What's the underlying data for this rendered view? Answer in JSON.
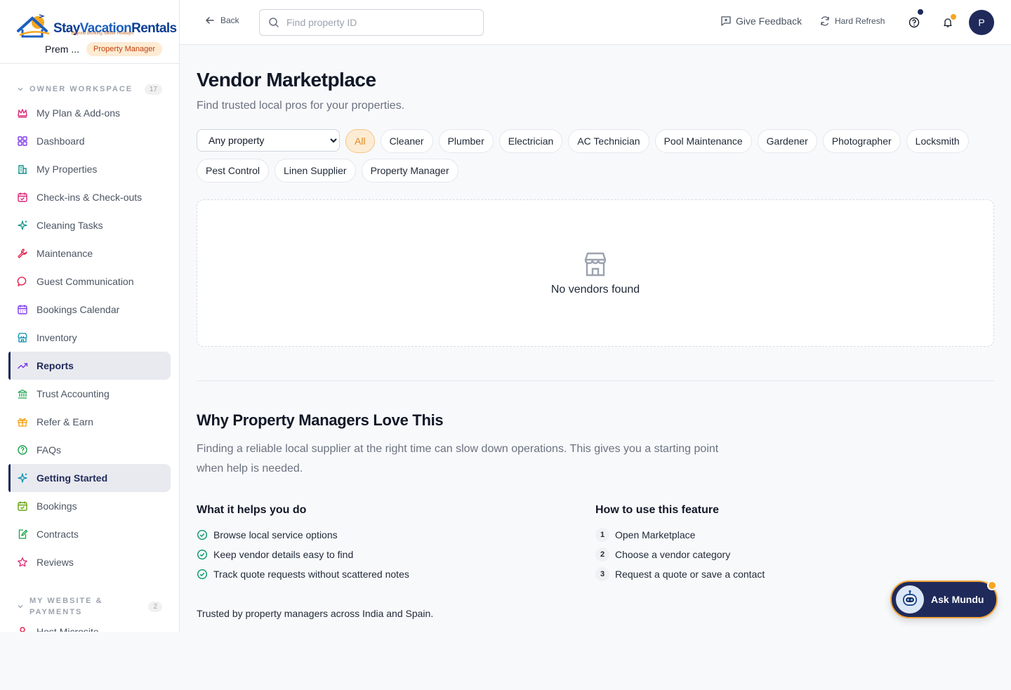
{
  "brand": {
    "logo_primary": "Stay",
    "logo_secondary": "Vacation",
    "logo_tertiary": "Rentals",
    "tagline": "Beyond Booking, Better Holidays.",
    "user_name": "Prem ...",
    "role": "Property Manager"
  },
  "sidebar": {
    "section1": {
      "title": "OWNER WORKSPACE",
      "count": "17"
    },
    "items": [
      {
        "label": "My Plan & Add-ons",
        "icon": "crown-icon",
        "color": "#db2777"
      },
      {
        "label": "Dashboard",
        "icon": "dashboard-icon",
        "color": "#7c3aed"
      },
      {
        "label": "My Properties",
        "icon": "building-icon",
        "color": "#0d9488"
      },
      {
        "label": "Check-ins & Check-outs",
        "icon": "calendar-check-icon",
        "color": "#db2777"
      },
      {
        "label": "Cleaning Tasks",
        "icon": "sparkles-icon",
        "color": "#0d9488"
      },
      {
        "label": "Maintenance",
        "icon": "wrench-icon",
        "color": "#e11d48"
      },
      {
        "label": "Guest Communication",
        "icon": "chat-icon",
        "color": "#e11d48"
      },
      {
        "label": "Bookings Calendar",
        "icon": "calendar-icon",
        "color": "#7c3aed"
      },
      {
        "label": "Inventory",
        "icon": "store-icon",
        "color": "#0891b2"
      },
      {
        "label": "Reports",
        "icon": "trending-icon",
        "color": "#7c3aed",
        "active": true
      },
      {
        "label": "Trust Accounting",
        "icon": "bank-icon",
        "color": "#16a34a"
      },
      {
        "label": "Refer & Earn",
        "icon": "gift-icon",
        "color": "#f59e0b"
      },
      {
        "label": "FAQs",
        "icon": "help-circle-icon",
        "color": "#16a34a"
      },
      {
        "label": "Getting Started",
        "icon": "sparkles-icon",
        "color": "#0891b2",
        "active": true
      },
      {
        "label": "Bookings",
        "icon": "calendar-check-icon",
        "color": "#65a30d"
      },
      {
        "label": "Contracts",
        "icon": "edit-doc-icon",
        "color": "#16a34a"
      },
      {
        "label": "Reviews",
        "icon": "star-icon",
        "color": "#db2777"
      }
    ],
    "section2": {
      "title_line1": "MY WEBSITE &",
      "title_line2": "PAYMENTS",
      "count": "2"
    },
    "items2": [
      {
        "label": "Host Microsite",
        "icon": "user-icon",
        "color": "#e11d48"
      }
    ]
  },
  "topbar": {
    "back_label": "Back",
    "search_placeholder": "Find property ID",
    "feedback_label": "Give Feedback",
    "refresh_label": "Hard Refresh",
    "avatar_initial": "P"
  },
  "main": {
    "title": "Vendor Marketplace",
    "subtitle": "Find trusted local pros for your properties.",
    "property_select": "Any property",
    "chips": [
      "All",
      "Cleaner",
      "Plumber",
      "Electrician",
      "AC Technician",
      "Pool Maintenance",
      "Gardener",
      "Photographer",
      "Locksmith",
      "Pest Control",
      "Linen Supplier",
      "Property Manager"
    ],
    "selected_chip": "All",
    "empty_message": "No vendors found",
    "why_title": "Why Property Managers Love This",
    "why_desc": "Finding a reliable local supplier at the right time can slow down operations. This gives you a starting point when help is needed.",
    "helps_title": "What it helps you do",
    "helps": [
      "Browse local service options",
      "Keep vendor details easy to find",
      "Track quote requests without scattered notes"
    ],
    "howto_title": "How to use this feature",
    "howto": [
      "Open Marketplace",
      "Choose a vendor category",
      "Request a quote or save a contact"
    ],
    "trusted": "Trusted by property managers across India and Spain."
  },
  "ask": {
    "label": "Ask Mundu"
  },
  "colors": {
    "accent": "#1f2a5a",
    "highlight": "#f5a623"
  }
}
